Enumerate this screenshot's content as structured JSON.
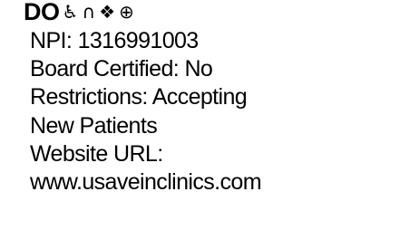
{
  "provider": {
    "credential": "DO",
    "icons": [
      {
        "name": "wheelchair-icon",
        "glyph": "♿"
      },
      {
        "name": "intersection-icon",
        "glyph": "∩"
      },
      {
        "name": "diamond-flourish-icon",
        "glyph": "❖"
      },
      {
        "name": "circle-cross-icon",
        "glyph": "⊕"
      }
    ],
    "npi_text": "NPI: 1316991003",
    "board_certified_text": "Board Certified: No",
    "restrictions_text": "Restrictions: Accepting New Patients",
    "website_text": "Website URL: www.usaveinclinics.com"
  }
}
